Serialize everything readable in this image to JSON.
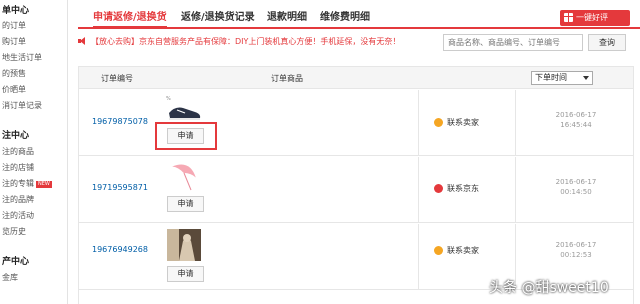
{
  "sidebar": {
    "sections": [
      {
        "title": "单中心",
        "items": [
          "的订单",
          "购订单",
          "地生活订单",
          "的预售",
          "价晒单",
          "消订单记录"
        ]
      },
      {
        "title": "注中心",
        "items": [
          "注的商品",
          "注的店铺",
          "注的专辑",
          "注的品牌",
          "注的活动",
          "览历史"
        ]
      },
      {
        "title": "产中心",
        "items": [
          "金库"
        ]
      }
    ],
    "new_badge": "NEW"
  },
  "tabs": [
    {
      "label": "申请返修/退换货"
    },
    {
      "label": "返修/退换货记录"
    },
    {
      "label": "退款明细"
    },
    {
      "label": "维修费明细"
    }
  ],
  "review_button": "一键好评",
  "notice": "【放心去购】京东自营服务产品有保障：DIY上门装机真心方便！手机延保，没有无奈！",
  "search": {
    "placeholder": "商品名称、商品编号、订单编号",
    "button": "查询"
  },
  "table": {
    "col_order_no": "订单编号",
    "col_product": "订单商品",
    "sort_label": "下单时间",
    "rows": [
      {
        "order_no": "19679875078",
        "apply": "申请",
        "seller": "联系卖家",
        "date": "2016-06-17",
        "time": "16:45:44",
        "thumb": "sneaker",
        "thumb_tag": "%"
      },
      {
        "order_no": "19719595871",
        "apply": "申请",
        "seller": "联系京东",
        "date": "2016-06-17",
        "time": "00:14:50",
        "thumb": "umbrella"
      },
      {
        "order_no": "19676949268",
        "apply": "申请",
        "seller": "联系卖家",
        "date": "2016-06-17",
        "time": "00:12:53",
        "thumb": "photo"
      }
    ]
  },
  "watermark": "头条 @甜sweet10",
  "colors": {
    "brand_red": "#e4393c",
    "link_blue": "#005ea7",
    "seller_orange": "#f5a623"
  }
}
